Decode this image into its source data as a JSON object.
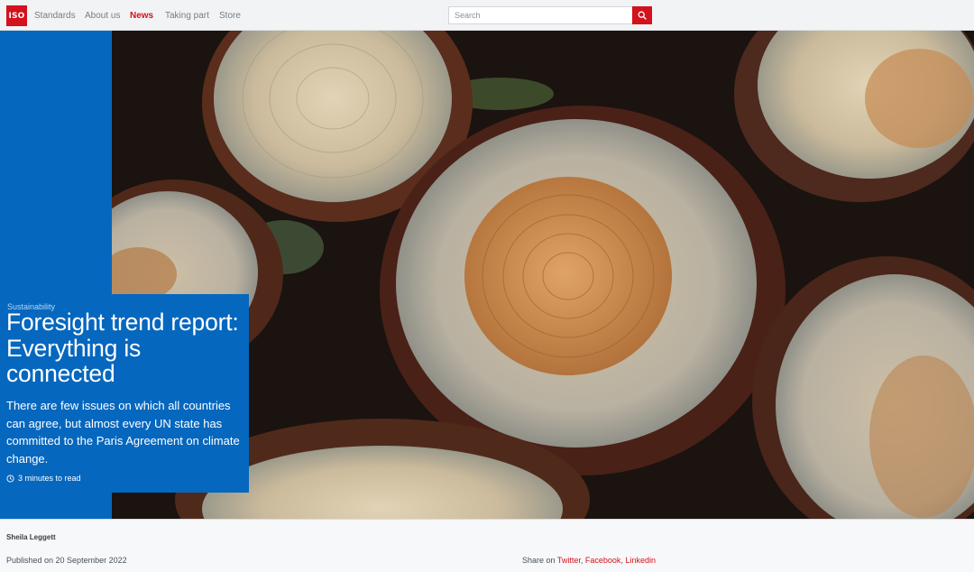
{
  "header": {
    "logo_text": "ISO",
    "nav": [
      "Standards",
      "About us",
      "News",
      "Taking part",
      "Store"
    ],
    "active_nav": "News",
    "search_placeholder": "Search"
  },
  "article": {
    "category": "Sustainability",
    "title": "Foresight trend report: Everything is connected",
    "lead": "There are few issues on which all countries can agree, but almost every UN state has committed to the Paris Agreement on climate change.",
    "read_time": "3 minutes to read"
  },
  "meta": {
    "author": "Sheila Leggett",
    "published": "Published on 20 September 2022",
    "share_label": "Share on",
    "share_links": [
      "Twitter",
      "Facebook",
      "Linkedin"
    ]
  },
  "colors": {
    "brand_red": "#d3121e",
    "brand_blue": "#0667be"
  },
  "icons": [
    "search-icon",
    "clock-icon"
  ]
}
